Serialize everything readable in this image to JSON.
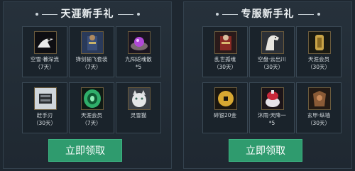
{
  "left_panel": {
    "title": "天涯新手礼",
    "items": [
      {
        "name": "空雪·暮深流",
        "days": "（7天）",
        "icon": "black-crow-icon"
      },
      {
        "name": "弹剑骊飞套装",
        "days": "（7天）",
        "icon": "warrior-outfit-icon"
      },
      {
        "name": "九阳返魂散",
        "days": "*5",
        "icon": "purple-orb-icon"
      },
      {
        "name": "赶手刃",
        "days": "（30天）",
        "icon": "armor-glove-icon"
      },
      {
        "name": "天涯会员",
        "days": "（7天）",
        "icon": "green-jade-badge-icon"
      },
      {
        "name": "灵雪猫",
        "days": "",
        "icon": "snow-cat-icon"
      }
    ],
    "button_label": "立即领取"
  },
  "right_panel": {
    "title": "专服新手礼",
    "items": [
      {
        "name": "乱世孤魂",
        "days": "（30天）",
        "icon": "red-armor-icon"
      },
      {
        "name": "空盘·云出川",
        "days": "（30天）",
        "icon": "white-horse-icon"
      },
      {
        "name": "天涯会员",
        "days": "（30天）",
        "icon": "gold-tag-icon"
      },
      {
        "name": "碎银20金",
        "days": "",
        "icon": "gold-coin-icon"
      },
      {
        "name": "沐雨·天降一",
        "days": "*5",
        "icon": "red-potion-icon"
      },
      {
        "name": "玄甲·纵墙",
        "days": "（30天）",
        "icon": "bronze-armor-icon"
      }
    ],
    "button_label": "立即领取"
  }
}
